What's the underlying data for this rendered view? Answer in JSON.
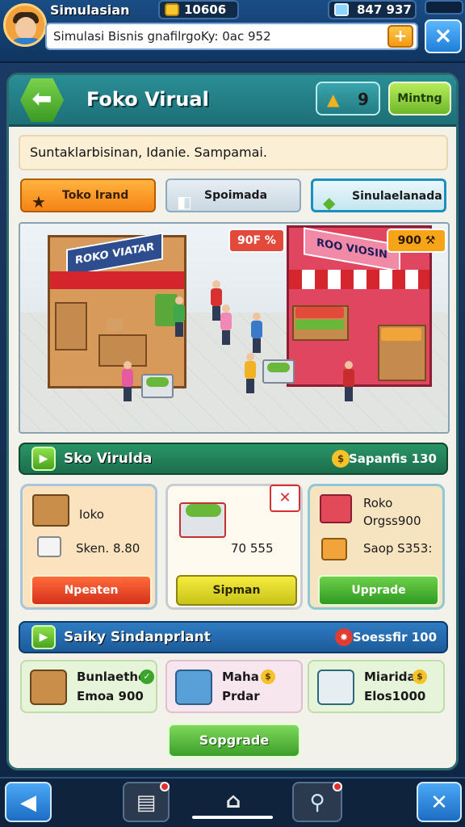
{
  "hud": {
    "game_name": "Simulasian",
    "coins": "10606",
    "gems": "847 937",
    "search_value": "Simulasi Bisnis gnafilrgoKy: 0ac 952",
    "search_icon": "plus-icon",
    "close_icon": "×"
  },
  "header": {
    "title": "Foko Virual",
    "rank_value": "9",
    "setting_label": "Mintng"
  },
  "notice": "Suntaklarbisinan, Idanie. Sampamai.",
  "tabs": [
    {
      "label": "Toko Irand",
      "icon": "★"
    },
    {
      "label": "Spoimada",
      "icon": "◧"
    },
    {
      "label": "Sinulaelanada",
      "icon": "◆"
    }
  ],
  "scene": {
    "left_sign": "ROKO VIATAR",
    "right_sign": "ROO VIOSIN",
    "left_price": "90F %",
    "right_price": "900 ⚒"
  },
  "section1": {
    "title": "Sko Virulda",
    "right_label": "Sapanfis 130"
  },
  "cards": [
    {
      "line1": "Ioko",
      "line2": "Sken. 8.80",
      "action": "Npeaten"
    },
    {
      "line1": "70 555",
      "action": "Sipman"
    },
    {
      "line1": "Roko",
      "line2": "Orgss900",
      "line3": "Saop S353:",
      "action": "Upprade"
    }
  ],
  "section2": {
    "title": "Saiky Sindanprlant",
    "right_label": "Soessfir 100"
  },
  "mini_cards": [
    {
      "line1": "Bunlaethe",
      "line2": "Emoa 900"
    },
    {
      "line1": "Maha",
      "line2": "Prdar"
    },
    {
      "line1": "Miarida",
      "line2": "Elos1000"
    }
  ],
  "upgrade_button": "Sopgrade",
  "colors": {
    "accent_teal": "#1e6f78",
    "accent_green": "#3c9f2a",
    "accent_orange": "#f48315",
    "nav_blue": "#1c6dc4"
  }
}
